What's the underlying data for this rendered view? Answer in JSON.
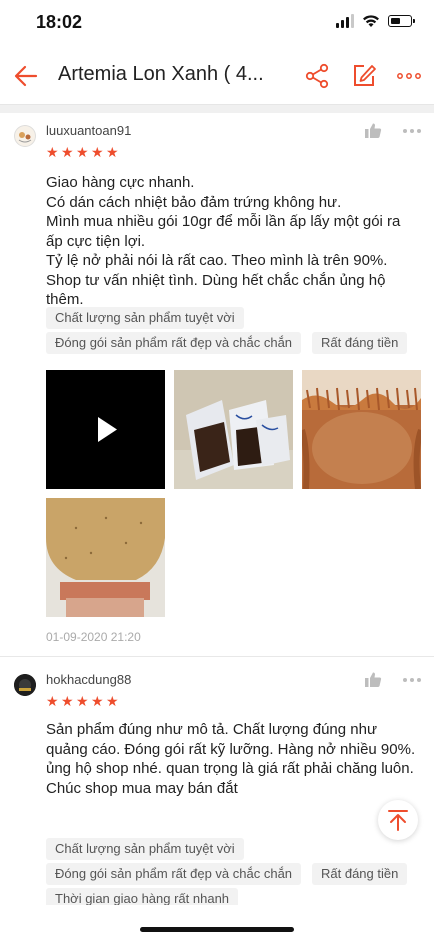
{
  "status": {
    "time": "18:02"
  },
  "header": {
    "title": "Artemia Lon Xanh ( 4...",
    "accent": "#ee4d2d",
    "back_icon": "arrow-left-icon",
    "share_icon": "share-icon",
    "edit_icon": "edit-icon",
    "more_icon": "more-dots-icon"
  },
  "reviews": [
    {
      "username": "luuxuantoan91",
      "rating": 5,
      "text": "Giao hàng cực nhanh.\nCó dán cách nhiệt bảo đảm trứng không hư.\nMình mua nhiều gói 10gr để mỗi lần ấp lấy một gói ra ấp cực tiện lợi.\nTỷ lệ nở phải nói là rất cao. Theo mình là trên 90%.\nShop tư vấn nhiệt tình. Dùng hết chắc chắn ủng hộ thêm.",
      "tags": [
        "Chất lượng sản phẩm tuyệt vời",
        "Đóng gói sản phẩm rất đẹp và chắc chắn",
        "Rất đáng tiền"
      ],
      "media": [
        "video",
        "photo-packets",
        "photo-hatching-jar",
        "photo-bottle"
      ],
      "date": "01-09-2020 21:20"
    },
    {
      "username": "hokhacdung88",
      "rating": 5,
      "text": "Sản phẩm đúng như mô tả. Chất lượng đúng như quảng cáo. Đóng gói rất kỹ lưỡng. Hàng nở nhiều 90%. ủng hộ shop nhé. quan trọng là giá rất phải chăng luôn. Chúc shop mua may bán đắt",
      "tags": [
        "Chất lượng sản phẩm tuyệt vời",
        "Đóng gói sản phẩm rất đẹp và chắc chắn",
        "Rất đáng tiền",
        "Thời gian giao hàng rất nhanh"
      ]
    }
  ]
}
